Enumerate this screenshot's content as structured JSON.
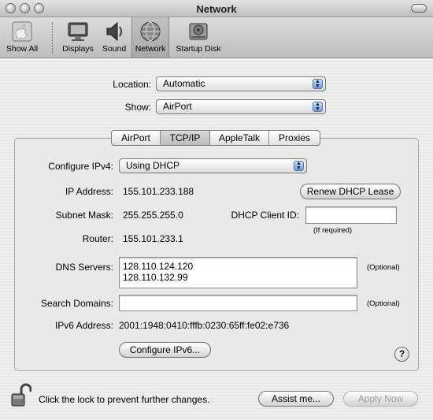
{
  "window": {
    "title": "Network"
  },
  "toolbar": {
    "show_all": "Show All",
    "displays": "Displays",
    "sound": "Sound",
    "network": "Network",
    "startup_disk": "Startup Disk"
  },
  "location": {
    "label": "Location:",
    "value": "Automatic"
  },
  "show": {
    "label": "Show:",
    "value": "AirPort"
  },
  "tabs": [
    "AirPort",
    "TCP/IP",
    "AppleTalk",
    "Proxies"
  ],
  "tcpip": {
    "configure_label": "Configure IPv4:",
    "configure_value": "Using DHCP",
    "ip_label": "IP Address:",
    "ip_value": "155.101.233.188",
    "renew_button": "Renew DHCP Lease",
    "subnet_label": "Subnet Mask:",
    "subnet_value": "255.255.255.0",
    "client_id_label": "DHCP Client ID:",
    "client_id_value": "",
    "if_required": "(If required)",
    "router_label": "Router:",
    "router_value": "155.101.233.1",
    "dns_label": "DNS Servers:",
    "dns_values": [
      "128.110.124.120",
      "128.110.132.99"
    ],
    "dns_optional": "(Optional)",
    "search_label": "Search Domains:",
    "search_value": "",
    "search_optional": "(Optional)",
    "ipv6_label": "IPv6 Address:",
    "ipv6_value": "2001:1948:0410:fffb:0230:65ff:fe02:e736",
    "configure_ipv6_button": "Configure IPv6...",
    "help": "?"
  },
  "footer": {
    "lock_text": "Click the lock to prevent further changes.",
    "assist_button": "Assist me...",
    "apply_button": "Apply Now"
  }
}
